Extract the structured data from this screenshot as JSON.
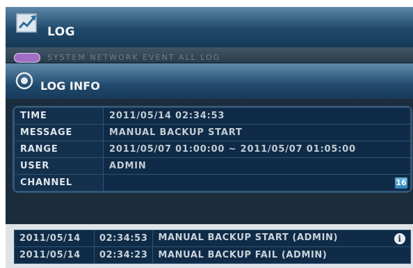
{
  "header": {
    "title": "LOG",
    "icon": "chart-icon"
  },
  "tabs": {
    "ghost_text": "SYSTEM   NETWORK   EVENT   ALL LOG"
  },
  "dialog": {
    "title": "LOG INFO",
    "icon": "ring-icon",
    "rows": [
      {
        "label": "TIME",
        "value": "2011/05/14 02:34:53"
      },
      {
        "label": "MESSAGE",
        "value": "MANUAL BACKUP START"
      },
      {
        "label": "RANGE",
        "value": "2011/05/07 01:00:00 ~ 2011/05/07 01:05:00"
      },
      {
        "label": "USER",
        "value": "ADMIN"
      },
      {
        "label": "CHANNEL",
        "value": ""
      }
    ],
    "channel_badge": "16"
  },
  "log_list": [
    {
      "date": "2011/05/14",
      "time": "02:34:53",
      "message": "MANUAL BACKUP START (ADMIN)",
      "info_icon": "i"
    },
    {
      "date": "2011/05/14",
      "time": "02:34:23",
      "message": "MANUAL BACKUP FAIL (ADMIN)"
    }
  ],
  "colors": {
    "title_bar": "#21496a",
    "table_bg": "#0f2b47",
    "table_border": "#2f5475",
    "badge": "#2f82b7",
    "tab_pill": "#a06ec3"
  }
}
